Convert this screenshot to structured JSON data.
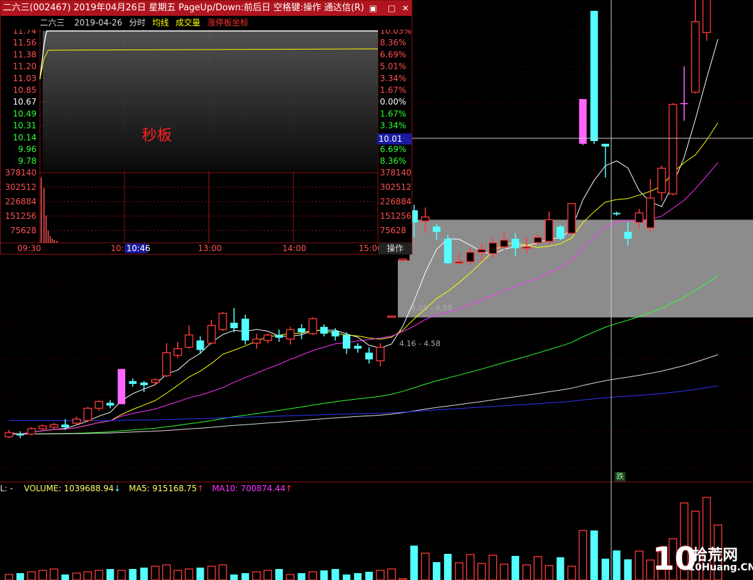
{
  "window": {
    "title": "二六三(002467) 2019年04月26日 星期五 PageUp/Down:前后日 空格键:操作 通达信(R)"
  },
  "intraday": {
    "stock_name": "二六三",
    "date": "2019-04-26",
    "mode_label": "分时",
    "legend": [
      {
        "label": "均线",
        "color": "#ffff00"
      },
      {
        "label": "成交量",
        "color": "#ffff00"
      },
      {
        "label": "涨停板坐标",
        "color": "#ff3030"
      }
    ],
    "annotation": "秒板",
    "price_ticks_left": [
      "11.74",
      "11.56",
      "11.38",
      "11.20",
      "11.03",
      "10.85",
      "10.67",
      "10.49",
      "10.31",
      "10.14",
      "9.96",
      "9.78"
    ],
    "pct_ticks_right": [
      "10.03%",
      "8.36%",
      "6.69%",
      "5.01%",
      "3.34%",
      "1.67%",
      "0.00%",
      "1.67%",
      "3.34%",
      "5.01%",
      "6.69%",
      "8.36%"
    ],
    "volume_ticks": [
      "378140",
      "302512",
      "226884",
      "151256",
      "75628"
    ],
    "time_ticks": [
      "09:30",
      "10:30",
      "13:00",
      "14:00",
      "15:00"
    ],
    "cursor_time": "10:46",
    "action_button": "操作",
    "crosshair_value": "10.01"
  },
  "zones": [
    {
      "label": "4.58 - 4.88"
    },
    {
      "label": "4.16 - 4.58"
    }
  ],
  "markers": {
    "die": "跌"
  },
  "volume_panel": {
    "prefix": "L: -",
    "volume": "VOLUME: 1039688.94",
    "volume_arrow": "↓",
    "ma5": "MA5: 915168.75",
    "ma5_arrow": "↑",
    "ma10": "MA10: 700874.44",
    "ma10_arrow": "↑"
  },
  "watermark": {
    "text1": "10",
    "text2": "拾荒网",
    "text3": "10Huang.CN"
  },
  "colors": {
    "up": "#ff3b3b",
    "down": "#54ffff",
    "limit": "#ff66ff",
    "ma5": "#ffffff",
    "ma10": "#ffff00",
    "ma20": "#ff33ff",
    "ma60": "#33ff33",
    "ma120": "#dddddd",
    "ma250": "#3333ff",
    "grid": "#8a1010"
  },
  "chart_data": {
    "type": "candlestick",
    "title": "",
    "ylim": [
      3.0,
      6.5
    ],
    "candles": [
      [
        3.28,
        3.31,
        3.27,
        3.33
      ],
      [
        3.3,
        3.29,
        3.27,
        3.32
      ],
      [
        3.3,
        3.34,
        3.29,
        3.35
      ],
      [
        3.34,
        3.36,
        3.33,
        3.37
      ],
      [
        3.35,
        3.37,
        3.34,
        3.38
      ],
      [
        3.37,
        3.35,
        3.33,
        3.41
      ],
      [
        3.38,
        3.41,
        3.37,
        3.43
      ],
      [
        3.4,
        3.49,
        3.39,
        3.5
      ],
      [
        3.49,
        3.54,
        3.47,
        3.55
      ],
      [
        3.53,
        3.51,
        3.49,
        3.55
      ],
      [
        3.52,
        3.78,
        3.52,
        3.78
      ],
      [
        3.69,
        3.67,
        3.65,
        3.71
      ],
      [
        3.68,
        3.66,
        3.61,
        3.69
      ],
      [
        3.68,
        3.7,
        3.66,
        3.71
      ],
      [
        3.73,
        3.9,
        3.72,
        3.97
      ],
      [
        3.88,
        3.93,
        3.86,
        3.98
      ],
      [
        3.94,
        4.03,
        3.93,
        4.1
      ],
      [
        3.99,
        3.92,
        3.89,
        4.02
      ],
      [
        3.97,
        4.1,
        3.96,
        4.14
      ],
      [
        4.07,
        4.19,
        4.06,
        4.2
      ],
      [
        4.12,
        4.08,
        4.05,
        4.23
      ],
      [
        4.15,
        3.99,
        3.96,
        4.18
      ],
      [
        3.97,
        4.0,
        3.93,
        4.04
      ],
      [
        3.99,
        4.03,
        3.97,
        4.04
      ],
      [
        4.03,
        4.01,
        3.98,
        4.07
      ],
      [
        4.0,
        4.07,
        3.96,
        4.09
      ],
      [
        4.08,
        4.05,
        4.0,
        4.11
      ],
      [
        4.04,
        4.15,
        4.03,
        4.16
      ],
      [
        4.09,
        4.04,
        4.02,
        4.11
      ],
      [
        4.06,
        4.02,
        3.99,
        4.08
      ],
      [
        4.03,
        3.93,
        3.89,
        4.05
      ],
      [
        3.95,
        3.93,
        3.9,
        3.97
      ],
      [
        3.9,
        3.85,
        3.82,
        3.94
      ],
      [
        3.84,
        3.94,
        3.8,
        3.97
      ],
      [
        4.16,
        4.17,
        4.16,
        4.17
      ],
      [
        4.58,
        4.59,
        4.58,
        4.59
      ],
      [
        4.95,
        4.86,
        4.75,
        4.99
      ],
      [
        4.87,
        4.9,
        4.78,
        4.97
      ],
      [
        4.83,
        4.79,
        4.73,
        4.85
      ],
      [
        4.74,
        4.56,
        4.55,
        4.77
      ],
      [
        4.56,
        4.57,
        4.55,
        4.63
      ],
      [
        4.57,
        4.64,
        4.55,
        4.68
      ],
      [
        4.64,
        4.66,
        4.58,
        4.71
      ],
      [
        4.63,
        4.71,
        4.6,
        4.75
      ],
      [
        4.68,
        4.73,
        4.66,
        4.79
      ],
      [
        4.74,
        4.67,
        4.61,
        4.78
      ],
      [
        4.67,
        4.68,
        4.63,
        4.75
      ],
      [
        4.71,
        4.75,
        4.7,
        4.77
      ],
      [
        4.72,
        4.88,
        4.7,
        4.94
      ],
      [
        4.83,
        4.74,
        4.73,
        4.84
      ],
      [
        4.78,
        5.0,
        4.77,
        5.0
      ],
      [
        5.44,
        5.77,
        5.43,
        5.77
      ],
      [
        6.42,
        5.46,
        5.44,
        6.42
      ],
      [
        5.44,
        5.42,
        5.19,
        5.44
      ],
      [
        4.93,
        4.92,
        4.91,
        4.94
      ],
      [
        4.79,
        4.74,
        4.69,
        4.86
      ],
      [
        4.86,
        4.93,
        4.81,
        4.96
      ],
      [
        4.82,
        5.04,
        4.79,
        5.18
      ],
      [
        5.08,
        5.26,
        5.02,
        5.28
      ],
      [
        5.07,
        5.73,
        5.06,
        5.74
      ],
      [
        5.74,
        5.74,
        5.61,
        6.01
      ],
      [
        5.82,
        6.34,
        5.81,
        6.55
      ],
      [
        6.26,
        6.55,
        6.2,
        6.8
      ],
      [
        6.55,
        6.7,
        6.5,
        6.88
      ]
    ],
    "limit_up_indices": [
      10,
      51,
      60
    ]
  }
}
